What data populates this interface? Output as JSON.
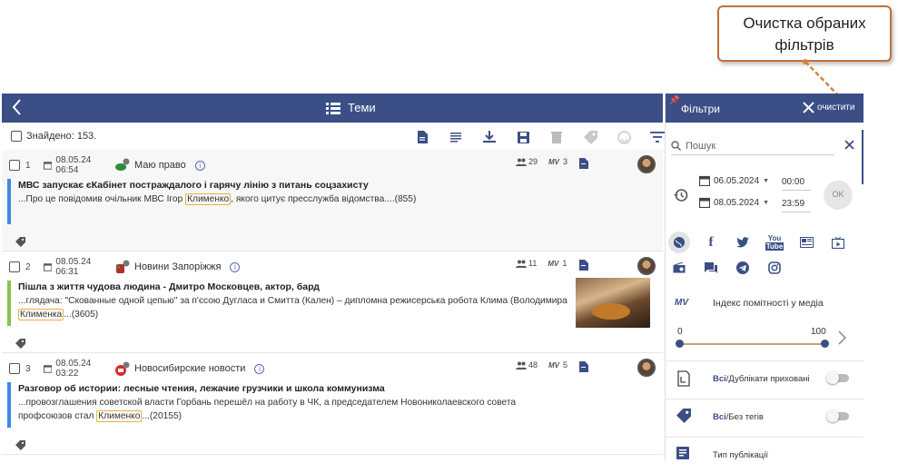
{
  "callout": {
    "text_line1": "Очистка обраних",
    "text_line2": "фільтрів"
  },
  "main": {
    "back_icon": "chevron-left-icon",
    "title": "Теми",
    "found_label": "Знайдено: 153."
  },
  "items": [
    {
      "num": "1",
      "date": "08.05.24 06:54",
      "source": "Маю право",
      "audience": "29",
      "mv": "3",
      "title": "МВС запускає єКабінет постраждалого і гарячу лінію з питань соцзахисту",
      "snippet_pre": "...Про це повідомив очільник МВС Ігор ",
      "highlight": "Клименко",
      "snippet_post": ", якого цитує пресслужба відомства....(855)",
      "accent": "#3b8be8"
    },
    {
      "num": "2",
      "date": "08.05.24 06:31",
      "source": "Новини Запоріжжя",
      "audience": "11",
      "mv": "1",
      "title": "Пішла з життя чудова людина - Дмитро Московцев, актор, бард",
      "snippet_pre": "...глядача: \"Скованные одной цепью\" за п'єсою Дугласа и Смитта (Кален) – дипломна режисерська робота Клима (Володимира ",
      "highlight": "Клименка",
      "snippet_post": "...(3605)",
      "accent": "#8bc34a"
    },
    {
      "num": "3",
      "date": "08.05.24 03:22",
      "source": "Новосибирские новости",
      "audience": "48",
      "mv": "5",
      "title": "Разговор об истории: лесные чтения, лежачие грузчики и школа коммунизма",
      "snippet_pre": "...провозглашения советской власти Горбань перешёл на работу в ЧК, а председателем Новониколаевского совета профсоюзов стал ",
      "highlight": "Клименко",
      "snippet_post": "...(20155)",
      "accent": "#3b8be8"
    }
  ],
  "filters": {
    "title": "Фільтри",
    "clear_label": "очистити",
    "search_placeholder": "Пошук",
    "date_from": "06.05.2024",
    "time_from": "00:00",
    "date_to": "08.05.2024",
    "time_to": "23:59",
    "ok_label": "OK",
    "mv_label": "MV",
    "index_label": "Індекс помітності у медіа",
    "slider_min": "0",
    "slider_max": "100",
    "slider_low": 0,
    "slider_high": 100,
    "dup_strong": "Всі",
    "dup_rest": "/Дублікати приховані",
    "tags_strong": "Всі",
    "tags_rest": "/Без тегів",
    "pub_type": "Тип публікації"
  },
  "colors": {
    "brand": "#3b4f86",
    "callout_border": "#c0703a",
    "highlight_border": "#e8b03a"
  }
}
